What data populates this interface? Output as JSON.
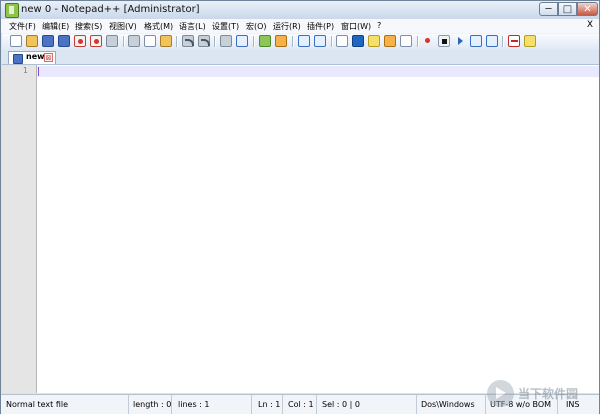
{
  "window": {
    "title": "new  0 - Notepad++ [Administrator]",
    "controls": {
      "minimize": "─",
      "maximize": "□",
      "close": "✕"
    }
  },
  "menu": {
    "items": [
      {
        "label": "文件(F)"
      },
      {
        "label": "编辑(E)"
      },
      {
        "label": "搜索(S)"
      },
      {
        "label": "视图(V)"
      },
      {
        "label": "格式(M)"
      },
      {
        "label": "语言(L)"
      },
      {
        "label": "设置(T)"
      },
      {
        "label": "宏(O)"
      },
      {
        "label": "运行(R)"
      },
      {
        "label": "插件(P)"
      },
      {
        "label": "窗口(W)"
      },
      {
        "label": "?"
      }
    ],
    "close_doc": "X"
  },
  "tab": {
    "label": "new",
    "close": "⊠"
  },
  "editor": {
    "line_numbers": [
      "1"
    ]
  },
  "status": {
    "doc_type": "Normal text file",
    "length": "length : 0",
    "lines": "lines : 1",
    "ln": "Ln : 1",
    "col": "Col : 1",
    "sel": "Sel : 0 | 0",
    "eol": "Dos\\Windows",
    "encoding": "UTF-8 w/o BOM",
    "mode": "INS"
  },
  "watermark": {
    "text": "当下软件园"
  },
  "toolbar_icons": [
    "new-file-icon",
    "open-file-icon",
    "save-icon",
    "save-all-icon",
    "close-icon",
    "close-all-icon",
    "print-icon",
    "cut-icon",
    "copy-icon",
    "paste-icon",
    "undo-icon",
    "redo-icon",
    "find-icon",
    "replace-icon",
    "zoom-in-icon",
    "zoom-out-icon",
    "sync-vertical-icon",
    "sync-horizontal-icon",
    "word-wrap-icon",
    "show-all-chars-icon",
    "indent-guide-icon",
    "doc-map-icon",
    "function-list-icon",
    "folder-as-workspace-icon",
    "monitor-icon",
    "record-macro-icon",
    "stop-macro-icon",
    "play-macro-icon",
    "run-macro-multiple-icon",
    "save-macro-icon",
    "spell-check-icon",
    "plugin-icon"
  ]
}
